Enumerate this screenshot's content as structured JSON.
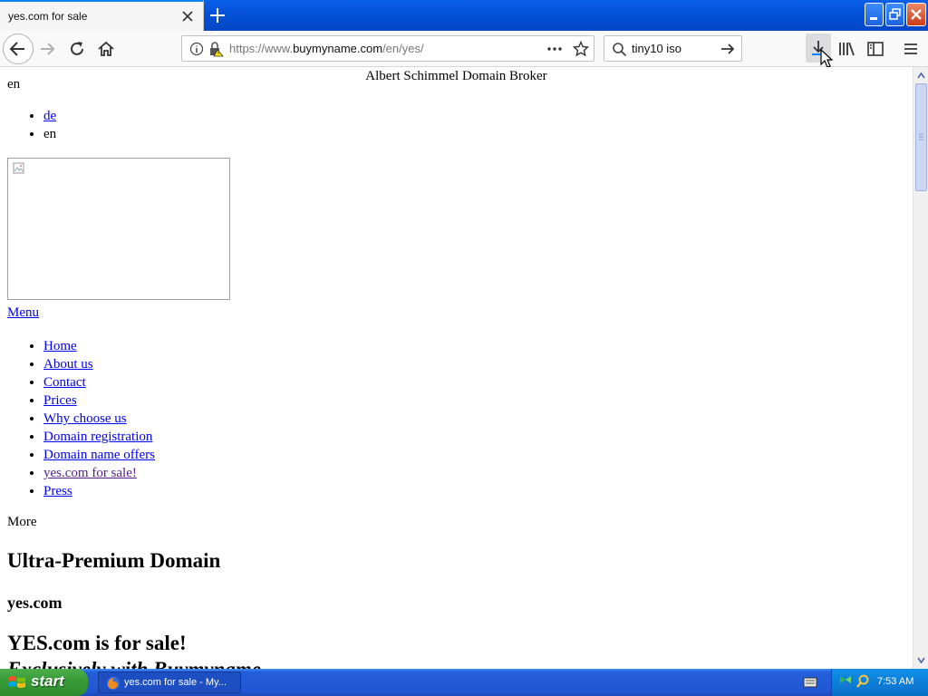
{
  "browser": {
    "tab_title": "yes.com for sale",
    "url_prefix": "https://www.",
    "url_host": "buymyname.com",
    "url_path": "/en/yes/",
    "search_value": "tiny10 iso"
  },
  "page": {
    "broker_title": "Albert Schimmel Domain Broker",
    "current_language": "en",
    "languages": [
      {
        "label": "de",
        "link": true
      },
      {
        "label": "en",
        "link": false
      }
    ],
    "menu_label": "Menu",
    "menu_items": [
      {
        "label": "Home"
      },
      {
        "label": "About us"
      },
      {
        "label": "Contact"
      },
      {
        "label": "Prices"
      },
      {
        "label": "Why choose us"
      },
      {
        "label": "Domain registration"
      },
      {
        "label": "Domain name offers"
      },
      {
        "label": "yes.com for sale!"
      },
      {
        "label": "Press"
      }
    ],
    "more_label": "More",
    "heading_ultra": "Ultra-Premium Domain",
    "heading_domain": "yes.com",
    "heading_forsale": "YES.com is for sale!",
    "heading_exclusive": "Exclusively with Buymyname"
  },
  "taskbar": {
    "start_label": "start",
    "task_label": "yes.com for sale - My...",
    "clock": "7:53 AM"
  },
  "colors": {
    "link": "#0000ee",
    "visited_link": "#551a8b",
    "titlebar_blue": "#0450d6",
    "start_green": "#389d38"
  }
}
